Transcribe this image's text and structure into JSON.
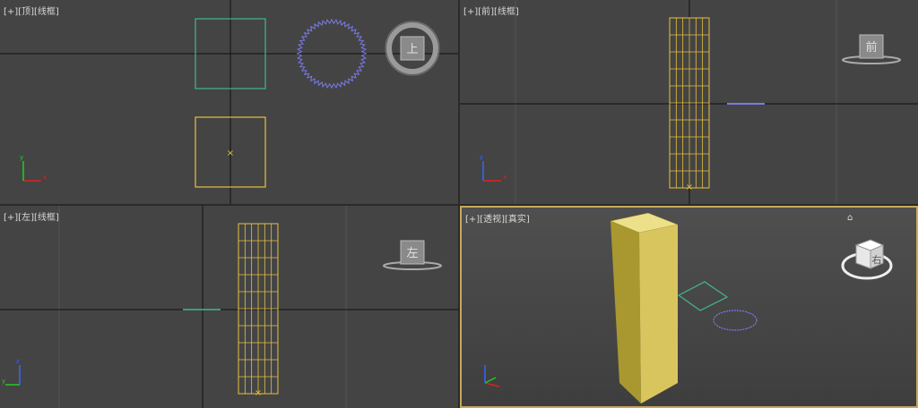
{
  "viewports": {
    "top": {
      "menu": "[+]",
      "view": "[顶]",
      "shading": "[线框]",
      "navcube_face": "上"
    },
    "front": {
      "menu": "[+]",
      "view": "[前]",
      "shading": "[线框]",
      "navcube_face": "前"
    },
    "left": {
      "menu": "[+]",
      "view": "[左]",
      "shading": "[线框]",
      "navcube_face": "左"
    },
    "perspective": {
      "menu": "[+]",
      "view": "[透视]",
      "shading": "[真实]",
      "navcube_face": "右"
    }
  },
  "colors": {
    "viewport_bg": "#444444",
    "active_border": "#c8a85a",
    "box_wire": "#e8c040",
    "plane_wire": "#3fb98a",
    "circle_wire": "#6a6ae8",
    "grid_major": "#111111",
    "grid_minor": "#555555",
    "box_shaded_front": "#d9c55e",
    "box_shaded_side": "#a8982f",
    "box_shaded_top": "#ede08a"
  },
  "axis_icons": [
    "x-axis",
    "y-axis",
    "z-axis"
  ]
}
